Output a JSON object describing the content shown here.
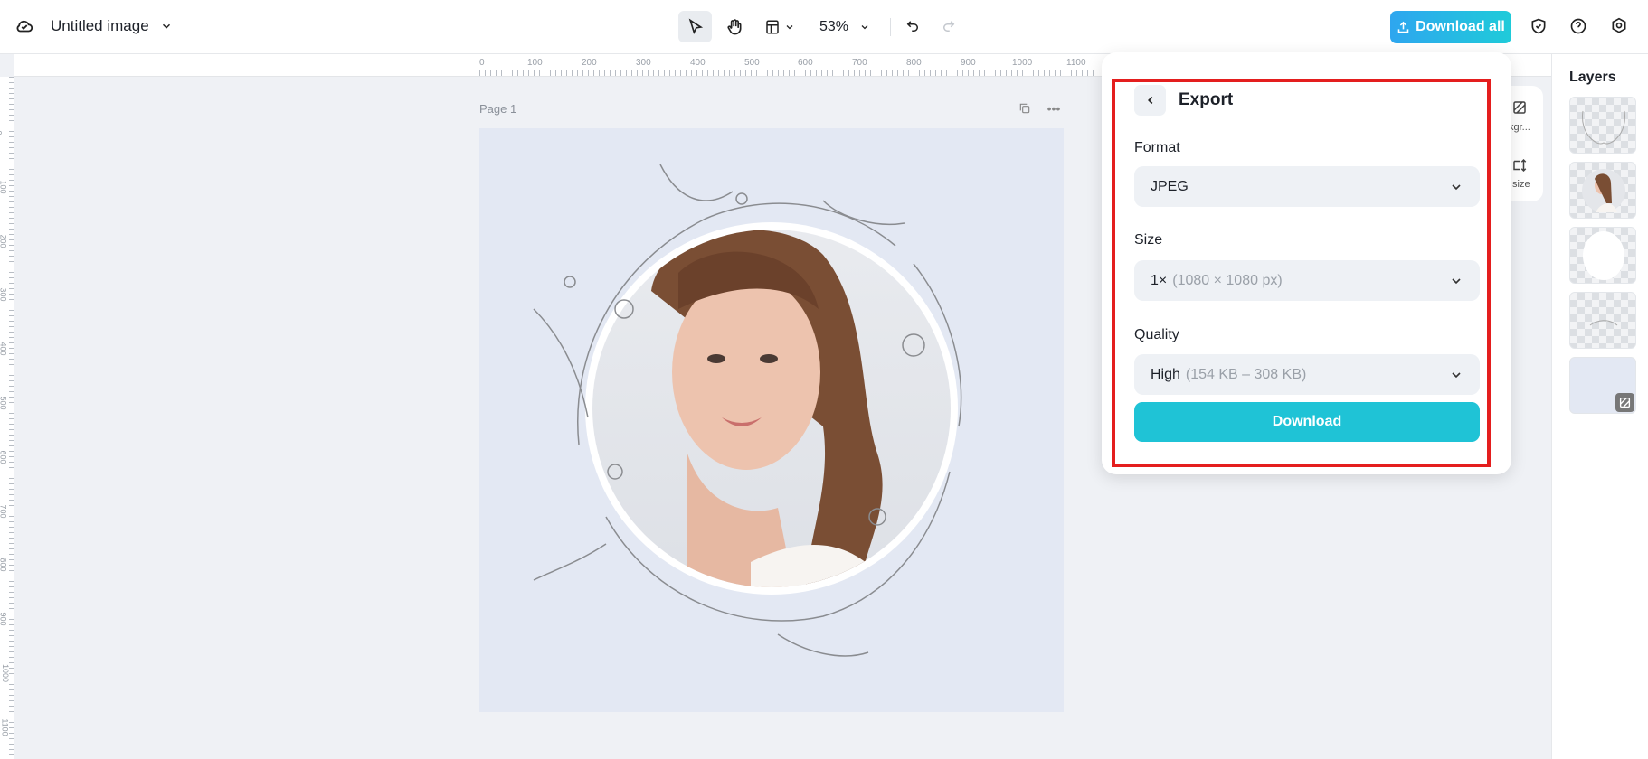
{
  "header": {
    "title": "Untitled image",
    "zoom": "53%",
    "download_all": "Download all"
  },
  "ruler": {
    "h_ticks": [
      "0",
      "100",
      "200",
      "300",
      "400",
      "500",
      "600",
      "700",
      "800",
      "900",
      "1000",
      "1100"
    ],
    "v_ticks": [
      "0",
      "100",
      "200",
      "300",
      "400",
      "500",
      "600",
      "700",
      "800",
      "900",
      "1000",
      "1100"
    ]
  },
  "canvas": {
    "page_label": "Page 1"
  },
  "side_tools": {
    "background_label": "kgr...",
    "resize_label": "size"
  },
  "export": {
    "title": "Export",
    "format_label": "Format",
    "format_value": "JPEG",
    "size_label": "Size",
    "size_value": "1×",
    "size_detail": "(1080 × 1080 px)",
    "quality_label": "Quality",
    "quality_value": "High",
    "quality_detail": "(154 KB – 308 KB)",
    "download": "Download"
  },
  "layers": {
    "title": "Layers"
  },
  "colors": {
    "accent": "#1fc3d6",
    "highlight": "#e41e1e"
  }
}
